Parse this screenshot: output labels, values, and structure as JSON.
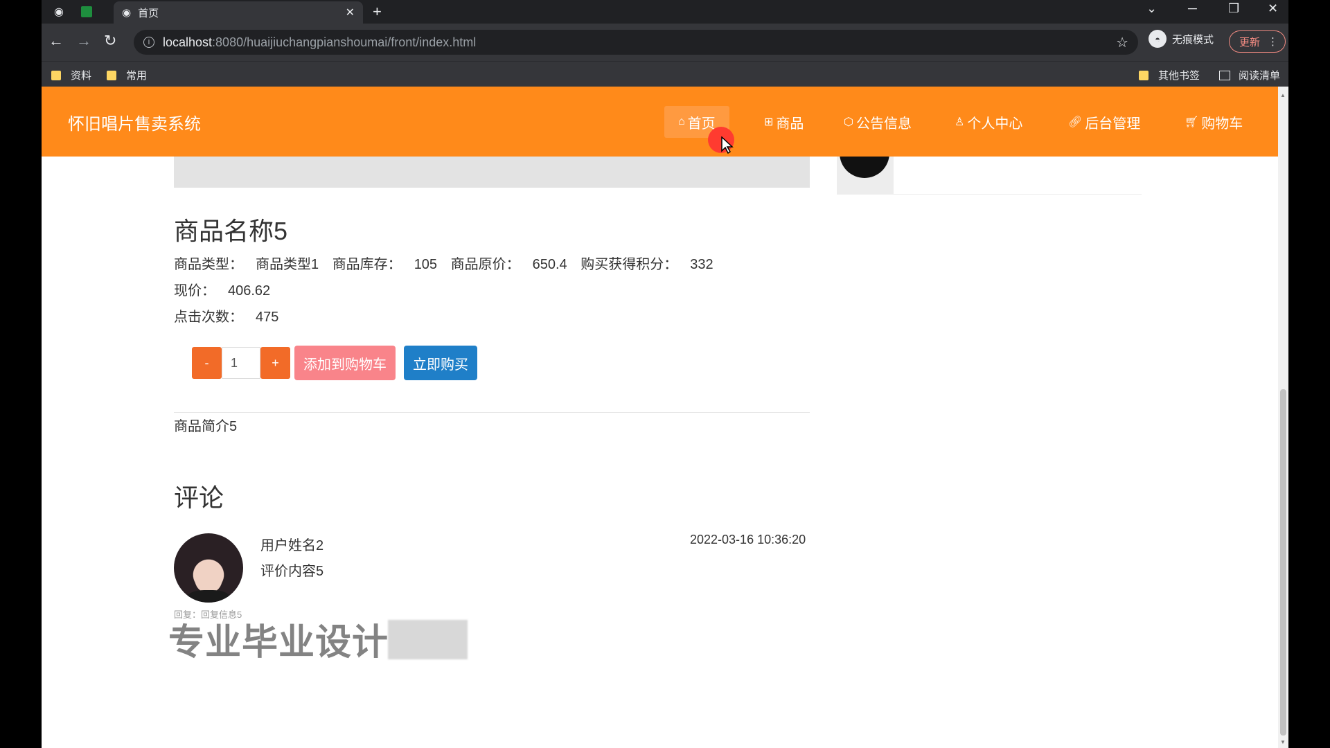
{
  "browser": {
    "tab_title": "首页",
    "url_host": "localhost",
    "url_path": ":8080/huaijiuchangpianshoumai/front/index.html",
    "incognito_label": "无痕模式",
    "update_label": "更新",
    "bookmarks": [
      "资料",
      "常用"
    ],
    "bookmarks_right": [
      "其他书签",
      "阅读清单"
    ]
  },
  "site": {
    "title": "怀旧唱片售卖系统",
    "nav": [
      {
        "label": "首页",
        "icon": "home-icon"
      },
      {
        "label": "商品",
        "icon": "grid-icon"
      },
      {
        "label": "公告信息",
        "icon": "cube-icon"
      },
      {
        "label": "个人中心",
        "icon": "user-icon"
      },
      {
        "label": "后台管理",
        "icon": "link-icon"
      },
      {
        "label": "购物车",
        "icon": "cart-icon"
      }
    ]
  },
  "product": {
    "name": "商品名称5",
    "attributes": [
      {
        "label": "商品类型：",
        "value": "商品类型1"
      },
      {
        "label": "商品库存：",
        "value": "105"
      },
      {
        "label": "商品原价：",
        "value": "650.4"
      },
      {
        "label": "购买获得积分：",
        "value": "332"
      },
      {
        "label": "现价：",
        "value": "406.62"
      },
      {
        "label": "点击次数：",
        "value": "475"
      }
    ],
    "quantity": "1",
    "minus_label": "-",
    "plus_label": "+",
    "add_to_cart_label": "添加到购物车",
    "buy_now_label": "立即购买",
    "description": "商品简介5"
  },
  "comments": {
    "title": "评论",
    "items": [
      {
        "user": "用户姓名2",
        "content": "评价内容5",
        "time": "2022-03-16 10:36:20",
        "reply": "回复：回复信息5"
      }
    ]
  },
  "watermark": "专业毕业设计",
  "colors": {
    "header": "#ff8a1a",
    "cart_button": "#f9848a",
    "buy_button": "#1f7fc8",
    "qty_button": "#f26b28"
  }
}
